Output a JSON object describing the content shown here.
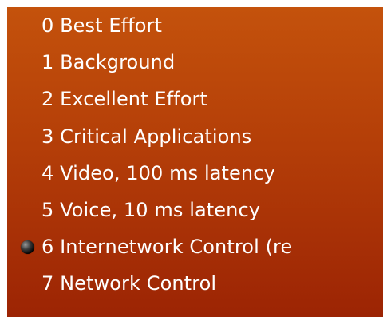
{
  "menu": {
    "selected_index": 6,
    "items": [
      {
        "label": "0 Best Effort"
      },
      {
        "label": "1 Background"
      },
      {
        "label": "2 Excellent Effort"
      },
      {
        "label": "3 Critical Applications"
      },
      {
        "label": "4 Video, 100 ms latency"
      },
      {
        "label": "5 Voice, 10 ms latency"
      },
      {
        "label": "6 Internetwork Control (re"
      },
      {
        "label": "7 Network Control"
      }
    ]
  },
  "colors": {
    "menu_top": "#c4520c",
    "menu_bottom": "#9c2404",
    "text": "#ffffff",
    "bullet": "#000000"
  },
  "icons": {
    "selected_marker": "radio-bullet-icon"
  }
}
